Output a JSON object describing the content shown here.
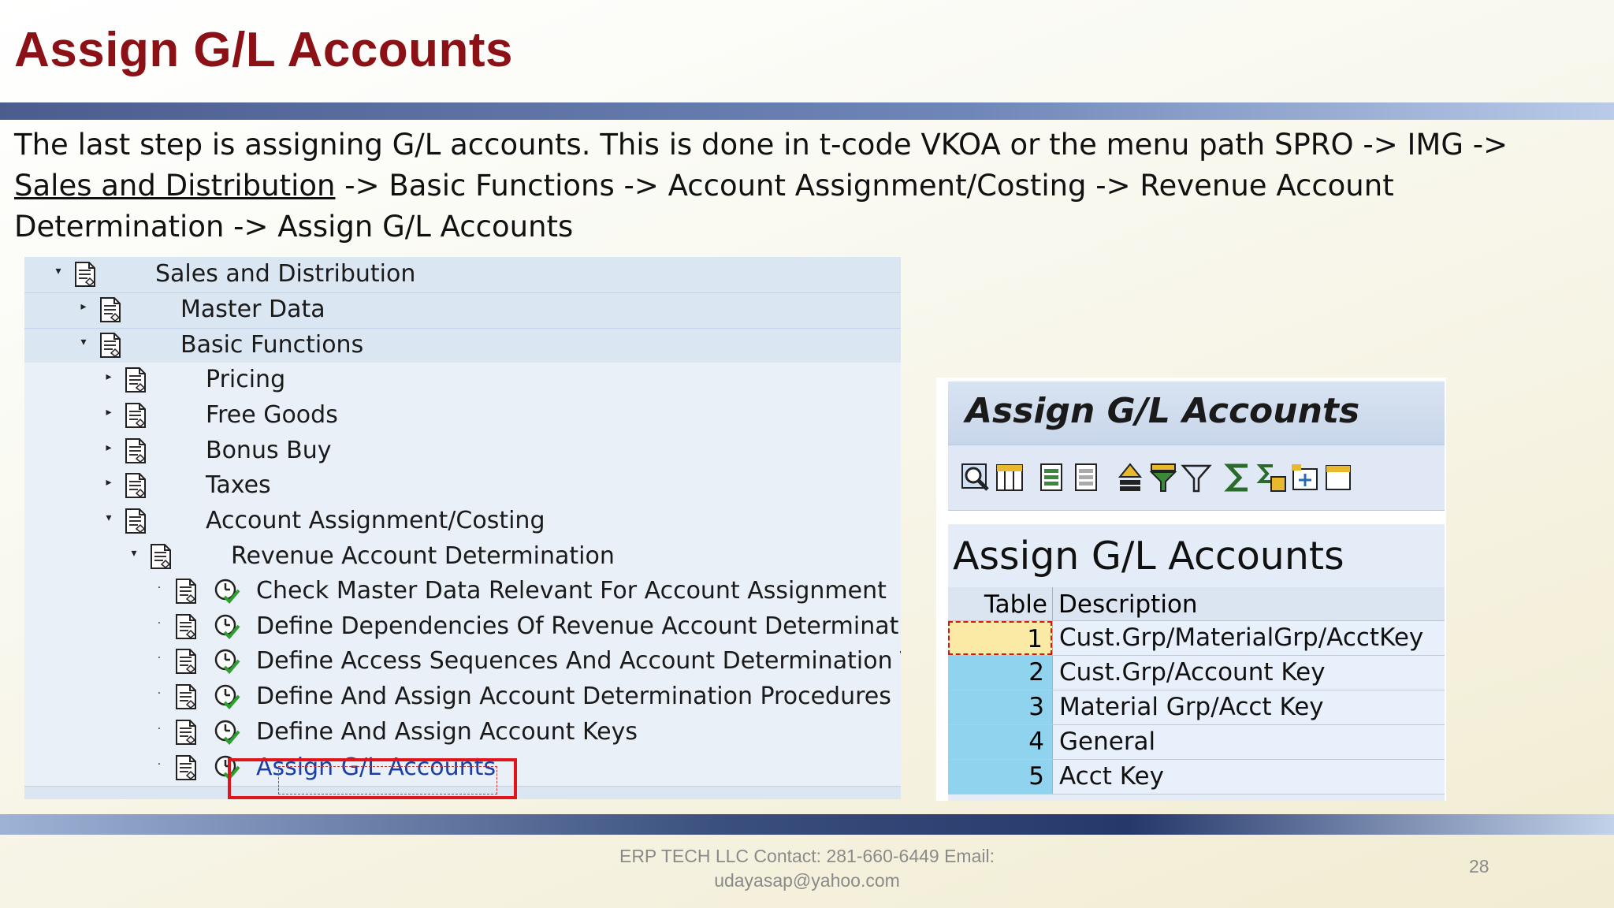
{
  "slide": {
    "title": "Assign G/L Accounts",
    "intro_part1": "The last step is assigning G/L accounts. This is done in t-code VKOA or the menu path SPRO -> IMG -> ",
    "intro_link": "Sales and Distribution",
    "intro_part2": " -> Basic Functions -> Account Assignment/Costing -> Revenue Account Determination -> Assign G/L Accounts"
  },
  "tree": {
    "items": [
      {
        "label": "Sales and Distribution",
        "toggle": "▾"
      },
      {
        "label": "Master Data",
        "toggle": "▸"
      },
      {
        "label": "Basic Functions",
        "toggle": "▾"
      },
      {
        "label": "Pricing",
        "toggle": "▸"
      },
      {
        "label": "Free Goods",
        "toggle": "▸"
      },
      {
        "label": "Bonus Buy",
        "toggle": "▸"
      },
      {
        "label": "Taxes",
        "toggle": "▸"
      },
      {
        "label": "Account Assignment/Costing",
        "toggle": "▾"
      },
      {
        "label": "Revenue Account Determination",
        "toggle": "▾"
      },
      {
        "label": "Check Master Data Relevant For Account Assignment",
        "toggle": "·"
      },
      {
        "label": "Define Dependencies Of Revenue Account Determination",
        "toggle": "·"
      },
      {
        "label": "Define Access Sequences And Account Determination Types",
        "toggle": "·"
      },
      {
        "label": "Define And Assign Account Determination Procedures",
        "toggle": "·"
      },
      {
        "label": "Define And Assign Account Keys",
        "toggle": "·"
      },
      {
        "label": "Assign G/L Accounts",
        "toggle": "·"
      }
    ]
  },
  "sap_window": {
    "title": "Assign G/L Accounts",
    "heading": "Assign G/L Accounts",
    "toolbar_icons": [
      "details-icon",
      "columns-icon",
      "select-all-icon",
      "deselect-all-icon",
      "sort-ascending-icon",
      "filter-icon",
      "set-filter-icon",
      "sum-icon",
      "subtotal-icon",
      "export-icon",
      "more-icon"
    ],
    "columns": {
      "table": "Table",
      "description": "Description"
    },
    "rows": [
      {
        "table": "1",
        "description": "Cust.Grp/MaterialGrp/AcctKey"
      },
      {
        "table": "2",
        "description": "Cust.Grp/Account Key"
      },
      {
        "table": "3",
        "description": "Material Grp/Acct Key"
      },
      {
        "table": "4",
        "description": "General"
      },
      {
        "table": "5",
        "description": "Acct Key"
      }
    ]
  },
  "footer": {
    "line1": "ERP TECH LLC Contact: 281-660-6449 Email:",
    "line2": "udayasap@yahoo.com",
    "page": "28"
  }
}
